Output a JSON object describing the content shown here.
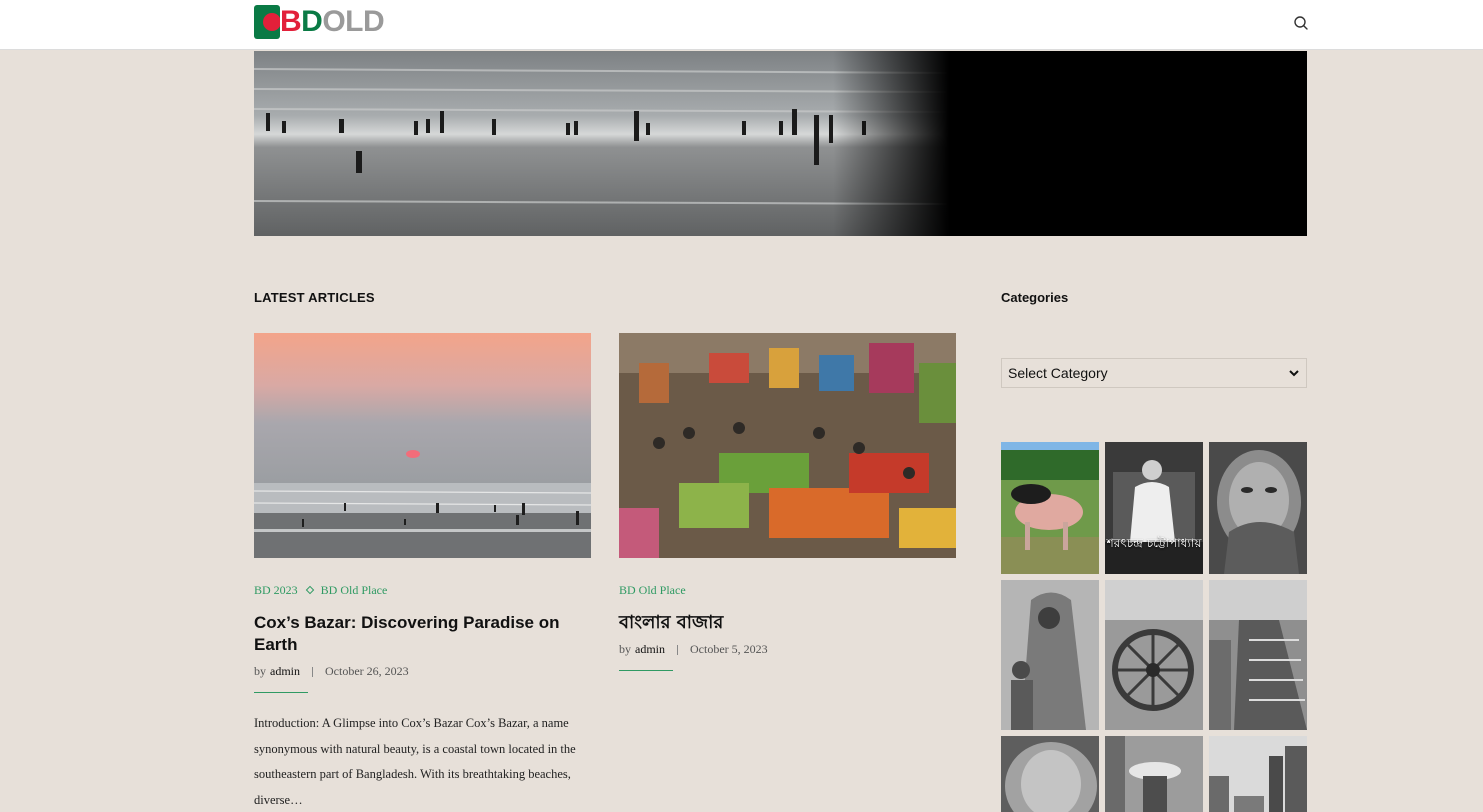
{
  "header": {
    "logo": {
      "part1": "B",
      "part2": "D",
      "part3": "OLD"
    }
  },
  "latest": {
    "heading": "LATEST ARTICLES"
  },
  "articles": [
    {
      "categories": [
        "BD 2023",
        "BD Old Place"
      ],
      "title": "Cox’s Bazar: Discovering Paradise on Earth",
      "by": "by",
      "author": "admin",
      "date": "October 26, 2023",
      "excerpt": "Introduction: A Glimpse into Cox’s Bazar Cox’s Bazar, a name synonymous with natural beauty, is a coastal town located in the southeastern part of Bangladesh. With its breathtaking beaches, diverse…"
    },
    {
      "categories": [
        "BD Old Place"
      ],
      "title": "বাংলার বাজার",
      "by": "by",
      "author": "admin",
      "date": "October 5, 2023"
    }
  ],
  "sidebar": {
    "heading": "Categories",
    "select": {
      "selected": "Select Category"
    },
    "gallery_caption": "শরৎচন্দ্র চট্টোপাধ্যায়"
  },
  "colors": {
    "accent": "#2f9a63",
    "background": "#e7e0d9",
    "brand_red": "#e2203a",
    "brand_green": "#0a7a45"
  },
  "icons": {
    "search": "search-icon",
    "dropdown": "chevron-down-icon"
  }
}
